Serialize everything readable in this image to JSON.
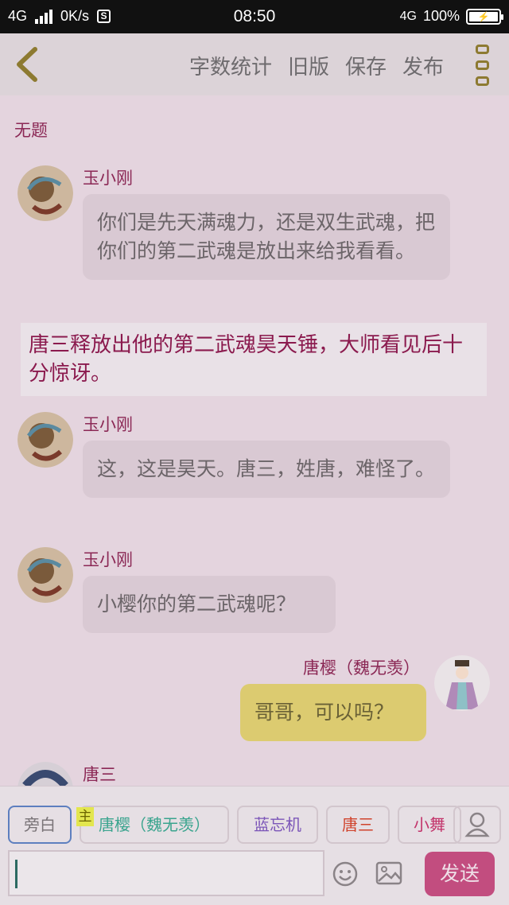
{
  "status_bar": {
    "network": "4G",
    "speed": "0K/s",
    "time": "08:50",
    "network_right": "4G",
    "battery": "100%"
  },
  "header": {
    "menu": [
      "字数统计",
      "旧版",
      "保存",
      "发布"
    ]
  },
  "chat": {
    "title": "无题",
    "messages": [
      {
        "sender": "玉小刚",
        "text": "你们是先天满魂力，还是双生武魂，把你们的第二武魂是放出来给我看看。"
      },
      {
        "narration": "唐三释放出他的第二武魂昊天锤，大师看见后十分惊讶。"
      },
      {
        "sender": "玉小刚",
        "text": "这，这是昊天。唐三，姓唐，难怪了。"
      },
      {
        "sender": "玉小刚",
        "text": "小樱你的第二武魂呢？"
      },
      {
        "sender": "唐樱（魏无羡）",
        "text": "哥哥，可以吗？"
      },
      {
        "sender": "唐三"
      }
    ]
  },
  "bottom": {
    "chips": [
      {
        "label": "旁白",
        "color": "#7a7478"
      },
      {
        "label": "唐樱（魏无羡）",
        "color": "#3aa48e"
      },
      {
        "label": "蓝忘机",
        "color": "#7b55b8"
      },
      {
        "label": "唐三",
        "color": "#d0432c"
      },
      {
        "label": "小舞",
        "color": "#c2336a"
      }
    ],
    "main_badge": "主",
    "input_value": "",
    "send_label": "发送"
  }
}
